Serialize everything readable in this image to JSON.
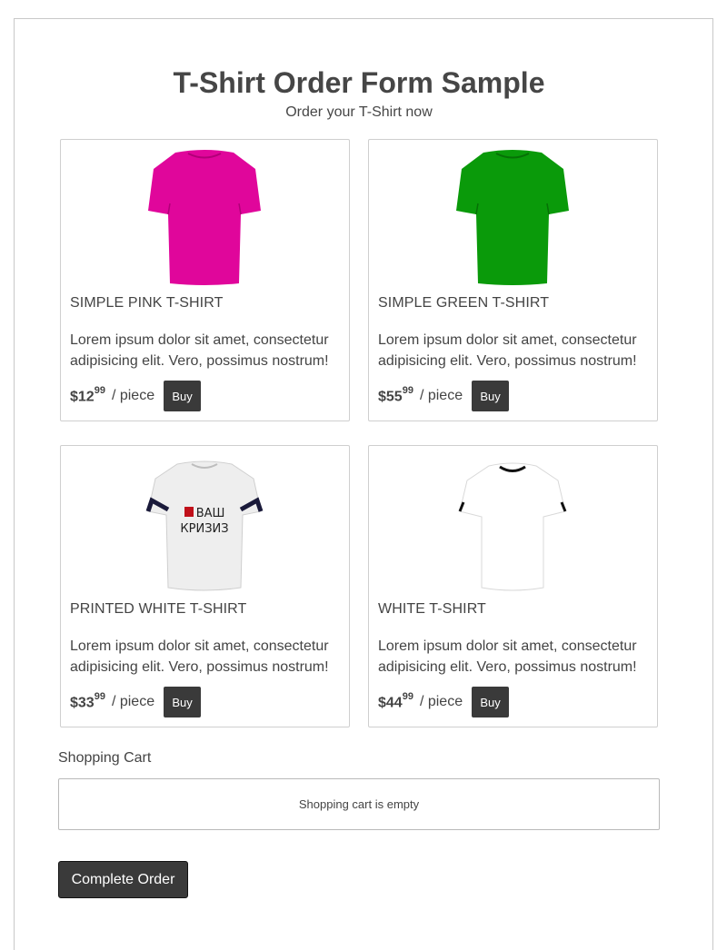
{
  "header": {
    "title": "T-Shirt Order Form Sample",
    "subtitle": "Order your T-Shirt now"
  },
  "products": [
    {
      "name": "SIMPLE PINK T-SHIRT",
      "description": "Lorem ipsum dolor sit amet, consectetur adipisicing elit. Vero, possimus nostrum!",
      "price_dollars": "$12",
      "price_cents": "99",
      "per": "/  piece",
      "buy_label": "Buy",
      "color": "#e0069b",
      "image": "pink-tshirt-image"
    },
    {
      "name": "SIMPLE GREEN T-SHIRT",
      "description": "Lorem ipsum dolor sit amet, consectetur adipisicing elit. Vero, possimus nostrum!",
      "price_dollars": "$55",
      "price_cents": "99",
      "per": "/  piece",
      "buy_label": "Buy",
      "color": "#0a9a0a",
      "image": "green-tshirt-image"
    },
    {
      "name": "PRINTED WHITE T-SHIRT",
      "description": "Lorem ipsum dolor sit amet, consectetur adipisicing elit. Vero, possimus nostrum!",
      "price_dollars": "$33",
      "price_cents": "99",
      "per": "/  piece",
      "buy_label": "Buy",
      "color": "#eeeeee",
      "print_text_line1": "Я ВАШ",
      "print_text_line2": "КРИЗИЗ",
      "image": "printed-white-tshirt-image"
    },
    {
      "name": "WHITE T-SHIRT",
      "description": "Lorem ipsum dolor sit amet, consectetur adipisicing elit. Vero, possimus nostrum!",
      "price_dollars": "$44",
      "price_cents": "99",
      "per": "/  piece",
      "buy_label": "Buy",
      "color": "#ffffff",
      "image": "white-tshirt-image"
    }
  ],
  "cart": {
    "label": "Shopping Cart",
    "empty_text": "Shopping cart is empty"
  },
  "complete_order_label": "Complete Order"
}
